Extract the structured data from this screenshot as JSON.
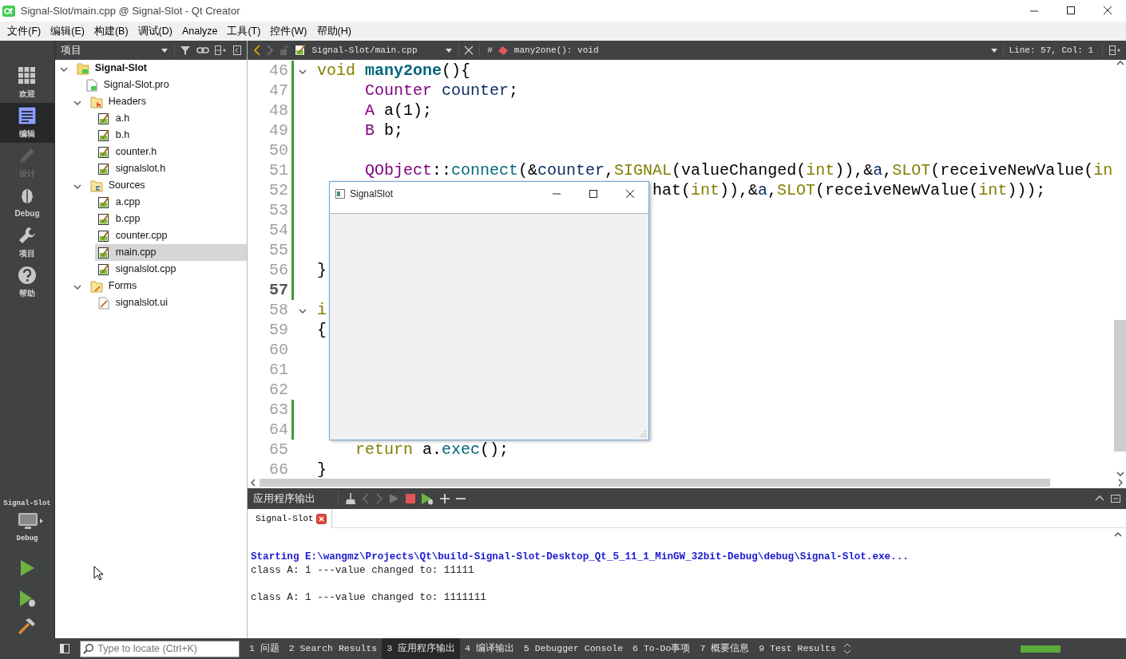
{
  "window": {
    "title": "Signal-Slot/main.cpp @ Signal-Slot - Qt Creator"
  },
  "menu": [
    "文件(F)",
    "编辑(E)",
    "构建(B)",
    "调试(D)",
    "Analyze",
    "工具(T)",
    "控件(W)",
    "帮助(H)"
  ],
  "mode_bar": {
    "modes": [
      {
        "label": "欢迎",
        "kind": "welcome",
        "selected": false,
        "disabled": false
      },
      {
        "label": "编辑",
        "kind": "edit",
        "selected": true,
        "disabled": false
      },
      {
        "label": "设计",
        "kind": "design",
        "selected": false,
        "disabled": true
      },
      {
        "label": "Debug",
        "kind": "debug",
        "selected": false,
        "disabled": false
      },
      {
        "label": "项目",
        "kind": "projects",
        "selected": false,
        "disabled": false
      },
      {
        "label": "帮助",
        "kind": "help",
        "selected": false,
        "disabled": false
      }
    ],
    "target": {
      "project": "Signal-Slot",
      "config": "Debug"
    }
  },
  "project_panel": {
    "title": "项目",
    "tree": [
      {
        "label": "Signal-Slot",
        "kind": "project",
        "expanded": true,
        "selected": false,
        "children": [
          {
            "label": "Signal-Slot.pro",
            "kind": "pro",
            "selected": false
          },
          {
            "label": "Headers",
            "kind": "header-folder",
            "expanded": true,
            "selected": false,
            "children": [
              {
                "label": "a.h",
                "kind": "source-file",
                "selected": false
              },
              {
                "label": "b.h",
                "kind": "source-file",
                "selected": false
              },
              {
                "label": "counter.h",
                "kind": "source-file",
                "selected": false
              },
              {
                "label": "signalslot.h",
                "kind": "source-file",
                "selected": false
              }
            ]
          },
          {
            "label": "Sources",
            "kind": "source-folder",
            "expanded": true,
            "selected": false,
            "children": [
              {
                "label": "a.cpp",
                "kind": "source-file",
                "selected": false
              },
              {
                "label": "b.cpp",
                "kind": "source-file",
                "selected": false
              },
              {
                "label": "counter.cpp",
                "kind": "source-file",
                "selected": false
              },
              {
                "label": "main.cpp",
                "kind": "source-file",
                "selected": true
              },
              {
                "label": "signalslot.cpp",
                "kind": "source-file",
                "selected": false
              }
            ]
          },
          {
            "label": "Forms",
            "kind": "form-folder",
            "expanded": true,
            "selected": false,
            "children": [
              {
                "label": "signalslot.ui",
                "kind": "form-file",
                "selected": false
              }
            ]
          }
        ]
      }
    ]
  },
  "editor": {
    "file": "Signal-Slot/main.cpp",
    "outline_marker": "#",
    "symbol": "many2one(): void",
    "position": "Line: 57, Col: 1",
    "lines": [
      {
        "number": "46",
        "modified": true,
        "fold": true,
        "current": false,
        "tokens": [
          {
            "kind": "keyword",
            "text": "void "
          },
          {
            "kind": "function-def",
            "text": "many2one"
          },
          {
            "kind": "plain",
            "text": "(){"
          }
        ]
      },
      {
        "number": "47",
        "modified": true,
        "fold": false,
        "current": false,
        "tokens": [
          {
            "kind": "type",
            "text": "     Counter"
          },
          {
            "kind": "local",
            "text": " counter"
          },
          {
            "kind": "plain",
            "text": ";"
          }
        ]
      },
      {
        "number": "48",
        "modified": true,
        "fold": false,
        "current": false,
        "tokens": [
          {
            "kind": "type",
            "text": "     A"
          },
          {
            "kind": "plain",
            "text": " a(1);"
          }
        ]
      },
      {
        "number": "49",
        "modified": true,
        "fold": false,
        "current": false,
        "tokens": [
          {
            "kind": "type",
            "text": "     B"
          },
          {
            "kind": "plain",
            "text": " b;"
          }
        ]
      },
      {
        "number": "50",
        "modified": true,
        "fold": false,
        "current": false
      },
      {
        "number": "51",
        "modified": true,
        "fold": false,
        "current": false,
        "tokens": [
          {
            "kind": "type",
            "text": "     QObject"
          },
          {
            "kind": "plain",
            "text": "::"
          },
          {
            "kind": "function",
            "text": "connect"
          },
          {
            "kind": "plain",
            "text": "(&"
          },
          {
            "kind": "local",
            "text": "counter"
          },
          {
            "kind": "plain",
            "text": ","
          },
          {
            "kind": "macro",
            "text": "SIGNAL"
          },
          {
            "kind": "plain",
            "text": "(valueChanged("
          },
          {
            "kind": "keyword",
            "text": "int"
          },
          {
            "kind": "plain",
            "text": ")),&"
          },
          {
            "kind": "local",
            "text": "a"
          },
          {
            "kind": "plain",
            "text": ","
          },
          {
            "kind": "macro",
            "text": "SLOT"
          },
          {
            "kind": "plain",
            "text": "(receiveNewValue("
          },
          {
            "kind": "keyword",
            "text": "in"
          }
        ]
      },
      {
        "number": "52",
        "modified": true,
        "fold": false,
        "current": false,
        "tokens": [
          {
            "kind": "plain",
            "text": "                                   hat("
          },
          {
            "kind": "keyword",
            "text": "int"
          },
          {
            "kind": "plain",
            "text": ")),&"
          },
          {
            "kind": "local",
            "text": "a"
          },
          {
            "kind": "plain",
            "text": ","
          },
          {
            "kind": "macro",
            "text": "SLOT"
          },
          {
            "kind": "plain",
            "text": "(receiveNewValue("
          },
          {
            "kind": "keyword",
            "text": "int"
          },
          {
            "kind": "plain",
            "text": ")));"
          }
        ]
      },
      {
        "number": "53",
        "modified": true,
        "fold": false,
        "current": false
      },
      {
        "number": "54",
        "modified": true,
        "fold": false,
        "current": false
      },
      {
        "number": "55",
        "modified": true,
        "fold": false,
        "current": false
      },
      {
        "number": "56",
        "modified": true,
        "fold": false,
        "current": false,
        "tokens": [
          {
            "kind": "plain",
            "text": "}"
          }
        ]
      },
      {
        "number": "57",
        "modified": true,
        "fold": false,
        "current": true
      },
      {
        "number": "58",
        "modified": false,
        "fold": true,
        "current": false,
        "tokens": [
          {
            "kind": "keyword",
            "text": "i"
          }
        ]
      },
      {
        "number": "59",
        "modified": false,
        "fold": false,
        "current": false,
        "tokens": [
          {
            "kind": "plain",
            "text": "{"
          }
        ]
      },
      {
        "number": "60",
        "modified": false,
        "fold": false,
        "current": false
      },
      {
        "number": "61",
        "modified": false,
        "fold": false,
        "current": false
      },
      {
        "number": "62",
        "modified": false,
        "fold": false,
        "current": false
      },
      {
        "number": "63",
        "modified": true,
        "fold": false,
        "current": false
      },
      {
        "number": "64",
        "modified": true,
        "fold": false,
        "current": false
      },
      {
        "number": "65",
        "modified": false,
        "fold": false,
        "current": false,
        "tokens": [
          {
            "kind": "keyword",
            "text": "    return"
          },
          {
            "kind": "plain",
            "text": " a."
          },
          {
            "kind": "function",
            "text": "exec"
          },
          {
            "kind": "plain",
            "text": "();"
          }
        ]
      },
      {
        "number": "66",
        "modified": false,
        "fold": false,
        "current": false,
        "tokens": [
          {
            "kind": "plain",
            "text": "}"
          }
        ]
      }
    ]
  },
  "popup_window": {
    "title": "SignalSlot"
  },
  "output": {
    "title": "应用程序输出",
    "tabs": [
      {
        "label": "Signal-Slot",
        "selected": true
      }
    ],
    "lines": [
      {
        "kind": "start",
        "text": "Starting E:\\wangmz\\Projects\\Qt\\build-Signal-Slot-Desktop_Qt_5_11_1_MinGW_32bit-Debug\\debug\\Signal-Slot.exe..."
      },
      {
        "kind": "plain",
        "text": "class A: 1 ---value changed to: 11111"
      },
      {
        "kind": "blank"
      },
      {
        "kind": "plain",
        "text": "class A: 1 ---value changed to: 1111111"
      }
    ]
  },
  "status_bar": {
    "locate_placeholder": "Type to locate (Ctrl+K)",
    "panes": [
      {
        "number": "1",
        "label": "问题",
        "selected": false
      },
      {
        "number": "2",
        "label": "Search Results",
        "selected": false
      },
      {
        "number": "3",
        "label": "应用程序输出",
        "selected": true
      },
      {
        "number": "4",
        "label": "编译输出",
        "selected": false
      },
      {
        "number": "5",
        "label": "Debugger Console",
        "selected": false
      },
      {
        "number": "6",
        "label": "To-Do事项",
        "selected": false
      },
      {
        "number": "7",
        "label": "概要信息",
        "selected": false
      },
      {
        "number": "9",
        "label": "Test Results",
        "selected": false
      }
    ],
    "progress": {
      "level": 1
    }
  }
}
